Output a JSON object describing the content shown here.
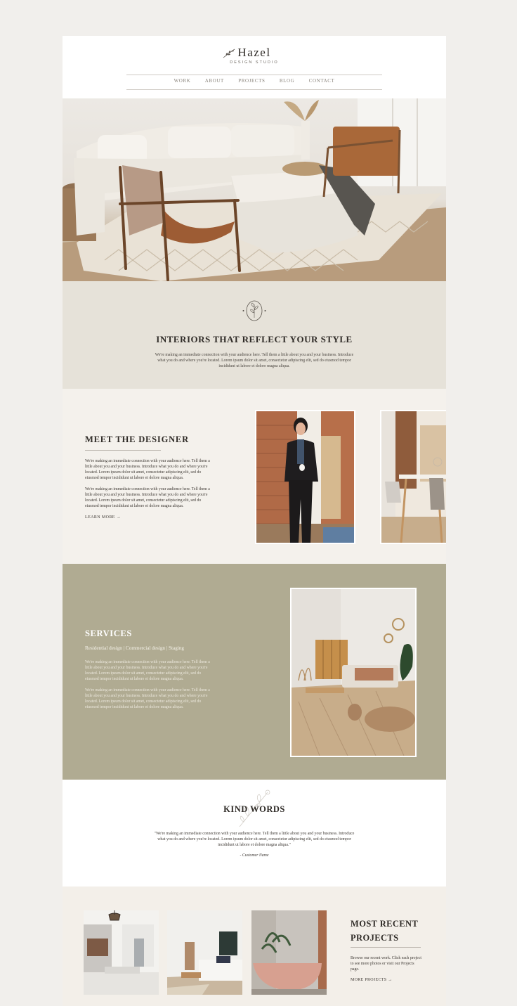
{
  "brand": {
    "name": "Hazel",
    "subtitle": "DESIGN STUDIO"
  },
  "nav": {
    "items": [
      "WORK",
      "ABOUT",
      "PROJECTS",
      "BLOG",
      "CONTACT"
    ]
  },
  "intro": {
    "title": "INTERIORS THAT REFLECT YOUR STYLE",
    "text": "We're making an immediate connection with your audience here. Tell them a little about you and your business. Introduce what you do and where you're located. Lorem ipsum dolor sit amet, consectetur adipiscing elit, sed do eiusmod tempor incididunt ut labore et dolore magna aliqua."
  },
  "meet": {
    "title": "MEET THE DESIGNER",
    "paragraphs": [
      "We're making an immediate connection with your audience here. Tell them a little about you and your business. Introduce what you do and where you're located. Lorem ipsum dolor sit amet, consectetur adipiscing elit, sed do eiusmod tempor incididunt ut labore et dolore magna aliqua.",
      "We're making an immediate connection with your audience here. Tell them a little about you and your business. Introduce what you do and where you're located. Lorem ipsum dolor sit amet, consectetur adipiscing elit, sed do eiusmod tempor incididunt ut labore et dolore magna aliqua."
    ],
    "link": "LEARN MORE →"
  },
  "services": {
    "title": "SERVICES",
    "categories": "Residential design | Commercial design | Staging",
    "paragraphs": [
      "We're making an immediate connection with your audience here. Tell them a little about you and your business. Introduce what you do and where you're located. Lorem ipsum dolor sit amet, consectetur adipiscing elit, sed do eiusmod tempor incididunt ut labore et dolore magna aliqua.",
      "We're making an immediate connection with your audience here. Tell them a little about you and your business. Introduce what you do and where you're located. Lorem ipsum dolor sit amet, consectetur adipiscing elit, sed do eiusmod tempor incididunt ut labore et dolore magna aliqua."
    ]
  },
  "kind_words": {
    "title": "KIND WORDS",
    "quote": "\"We're making an immediate connection with your audience here. Tell them a little about you and your business. Introduce what you do and where you're located. Lorem ipsum dolor sit amet, consectetur adipiscing elit, sed do eiusmod tempor incididunt ut labore et dolore magna aliqua.\"",
    "author": "- Customer Name"
  },
  "projects": {
    "title_line1": "MOST RECENT",
    "title_line2": "PROJECTS",
    "text": "Browse our recent work. Click each project to see more photos or visit our Projects page.",
    "link": "MORE PROJECTS →"
  },
  "icons": [
    "sprig-icon",
    "floral-emblem-icon",
    "sprig-illustration-icon"
  ],
  "colors": {
    "page_bg": "#f1efec",
    "intro_bg": "#e6e2d9",
    "meet_bg": "#f4f1ec",
    "services_bg": "#b0ab92",
    "projects_bg": "#f3efe9",
    "text": "#2f2b27"
  }
}
